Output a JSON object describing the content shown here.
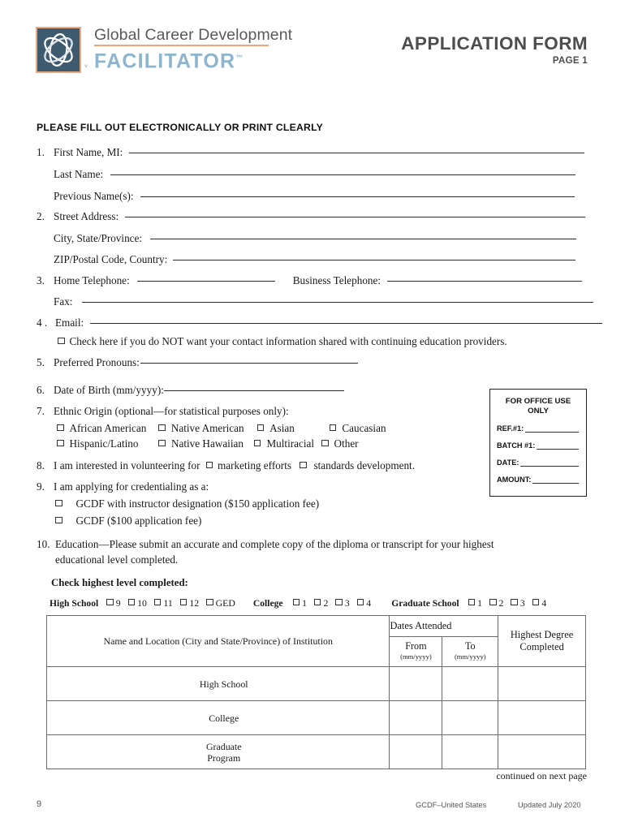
{
  "header": {
    "logo_line1": "Global Career Development",
    "logo_line2": "FACILITATOR",
    "logo_tm": "™",
    "title": "APPLICATION FORM",
    "page_label": "PAGE 1",
    "brand_orange": "#e8a87c",
    "brand_slate": "#3e5a6e",
    "brand_lightblue": "#8fb4cd",
    "title_gray": "#4d4d4d"
  },
  "instruction": "PLEASE FILL OUT ELECTRONICALLY OR PRINT CLEARLY",
  "fields": {
    "q1_num": "1.",
    "q1_label": "First Name, MI:",
    "q1b_label": "Last Name:",
    "q1c_label": "Previous Name(s):",
    "q2_num": "2.",
    "q2_label": "Street Address:",
    "q2b_label": "City, State/Province:",
    "q2c_label": "ZIP/Postal Code, Country:",
    "q3_num": "3.",
    "q3_label": "Home Telephone:",
    "q3_label2": "Business Telephone:",
    "q3b_label": "Fax:",
    "q4_num": "4 .",
    "q4_label": "Email:",
    "q4_optout": "Check here if you do NOT want your contact information shared with continuing education providers.",
    "q5_num": "5.",
    "q5_label": "Preferred Pronouns:",
    "q6_num": "6.",
    "q6_label": "Date of Birth (mm/yyyy):",
    "q7_num": "7.",
    "q7_label": "Ethnic Origin (optional—for statistical purposes only):",
    "q8_num": "8.",
    "q8_pre": "I am interested in volunteering for",
    "q8_opt1": "marketing efforts",
    "q8_opt2": "standards development.",
    "q9_num": "9.",
    "q9_label": "I am applying for credentialing as a:",
    "q9_opt1": "GCDF with instructor designation ($150 application fee)",
    "q9_opt2": "GCDF ($100 application fee)",
    "q10_num": "10.",
    "q10_line1": "Education—Please submit an accurate and complete copy of the diploma or transcript for your highest",
    "q10_line2": "educational level completed."
  },
  "ethnic_options_row1": [
    "African American",
    "Native American",
    "Asian",
    "Caucasian"
  ],
  "ethnic_options_row2": [
    "Hispanic/Latino",
    "Native Hawaiian",
    "Multiracial",
    "Other"
  ],
  "office_box": {
    "title_line1": "FOR OFFICE USE",
    "title_line2": "ONLY",
    "field_ref": "REF.#1:",
    "field_batch": "BATCH #1:",
    "field_date": "DATE:",
    "field_amount": "AMOUNT:"
  },
  "education": {
    "check_heading": "Check highest level completed:",
    "groups": [
      {
        "label": "High School",
        "options": [
          "9",
          "10",
          "11",
          "12",
          "GED"
        ]
      },
      {
        "label": "College",
        "options": [
          "1",
          "2",
          "3",
          "4"
        ]
      },
      {
        "label": "Graduate School",
        "options": [
          "1",
          "2",
          "3",
          "4"
        ]
      }
    ],
    "table": {
      "col_name": "Name and Location (City and State/Province) of Institution",
      "col_dates": "Dates Attended",
      "col_from": "From",
      "col_from_hint": "(mm/yyyy)",
      "col_to": "To",
      "col_to_hint": "(mm/yyyy)",
      "col_degree_line1": "Highest Degree",
      "col_degree_line2": "Completed",
      "rows": [
        {
          "label": "High School",
          "label2": ""
        },
        {
          "label": "College",
          "label2": ""
        },
        {
          "label": "Graduate",
          "label2": "Program"
        }
      ]
    }
  },
  "footer": {
    "continued": "continued on next page",
    "page_number": "9",
    "organization": "GCDF–United States",
    "updated": "Updated July 2020"
  }
}
